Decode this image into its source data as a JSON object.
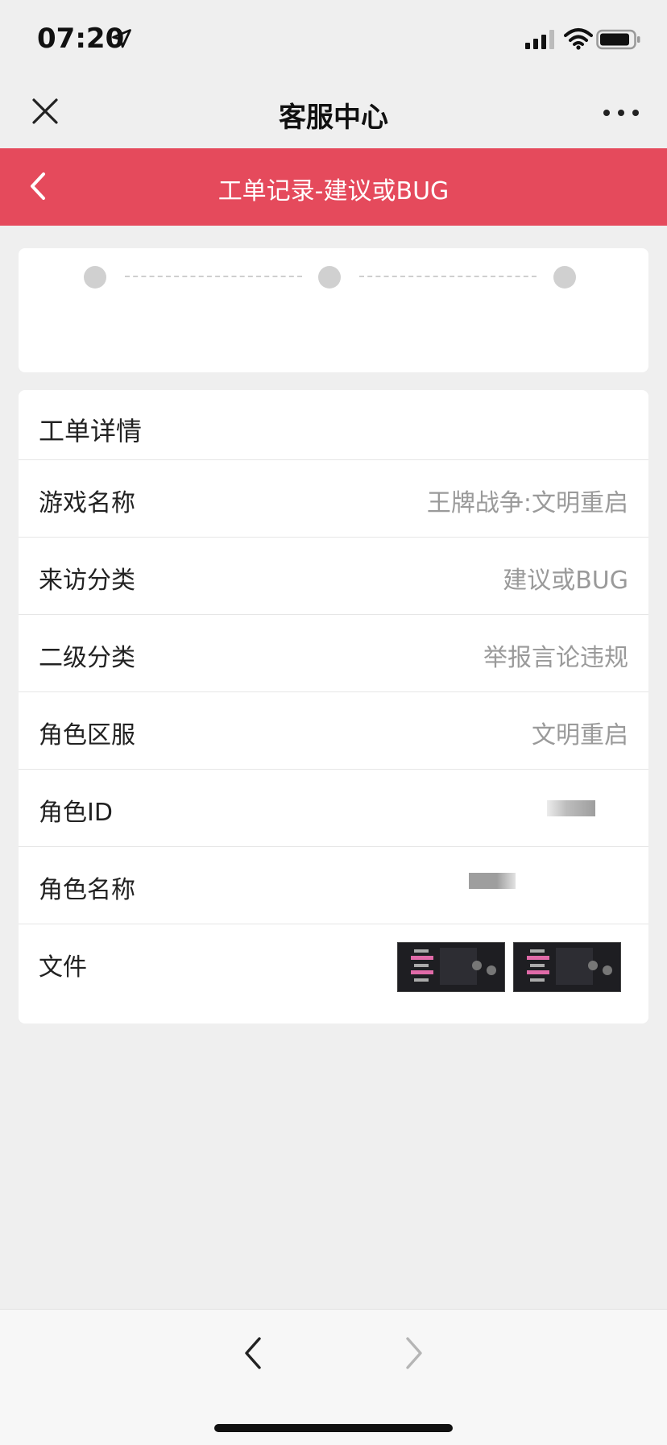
{
  "status_bar": {
    "time": "07:20",
    "icons": [
      "location-arrow-icon",
      "signal-icon",
      "wifi-icon",
      "battery-icon"
    ]
  },
  "top_nav": {
    "title": "客服中心",
    "left_icon": "close-icon",
    "right_icon": "more-icon"
  },
  "header": {
    "title": "工单记录-建议或BUG",
    "back_icon": "chevron-left-icon",
    "color": "#e54a5c"
  },
  "progress": {
    "steps": 3
  },
  "details": {
    "title": "工单详情",
    "rows": [
      {
        "label": "游戏名称",
        "value": "王牌战争:文明重启"
      },
      {
        "label": "来访分类",
        "value": "建议或BUG"
      },
      {
        "label": "二级分类",
        "value": "举报言论违规"
      },
      {
        "label": "角色区服",
        "value": "文明重启"
      },
      {
        "label": "角色ID",
        "value": ""
      },
      {
        "label": "角色名称",
        "value": ""
      },
      {
        "label": "文件",
        "value": ""
      }
    ]
  },
  "bottom_nav": {
    "back_icon": "chevron-left-icon",
    "forward_icon": "chevron-right-icon"
  }
}
